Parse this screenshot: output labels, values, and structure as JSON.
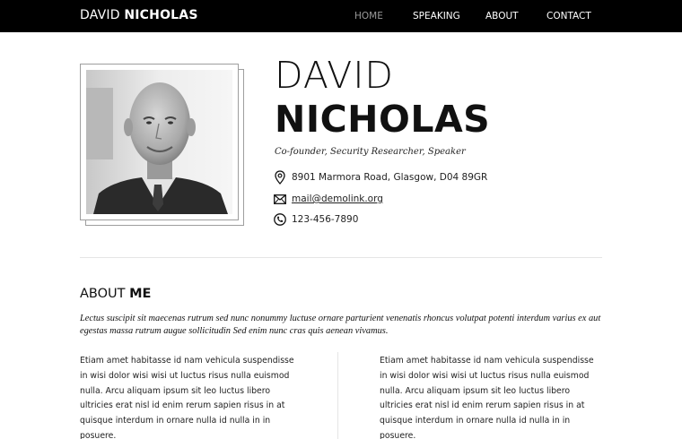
{
  "header": {
    "brand_first": "DAVID",
    "brand_last": "NICHOLAS",
    "nav": [
      {
        "label": "HOME",
        "active": true
      },
      {
        "label": "SPEAKING",
        "active": false
      },
      {
        "label": "ABOUT",
        "active": false
      },
      {
        "label": "CONTACT",
        "active": false
      }
    ]
  },
  "profile": {
    "first_name": "DAVID",
    "last_name": "NICHOLAS",
    "tagline": "Co-founder, Security Researcher, Speaker",
    "address": "8901 Marmora Road, Glasgow, D04 89GR",
    "email": "mail@demolink.org",
    "phone": "123-456-7890",
    "icons": [
      "map-pin-icon",
      "envelope-icon",
      "phone-icon"
    ]
  },
  "about": {
    "title_normal": "ABOUT",
    "title_bold": "ME",
    "intro": "Lectus suscipit sit maecenas rutrum sed nunc nonummy luctuse ornare parturient venenatis rhoncus volutpat potenti interdum varius ex aut egestas massa rutrum augue sollicitudin Sed enim nunc cras quis aenean vivamus.",
    "col_left": "Etiam amet  habitasse id nam vehicula suspendisse in wisi dolor wisi wisi ut luctus risus nulla euismod nulla. Arcu aliquam ipsum sit leo luctus libero ultricies erat nisl id enim rerum sapien risus in at quisque interdum in ornare nulla id nulla in in posuere.",
    "col_right": "Etiam amet  habitasse id nam vehicula suspendisse in wisi dolor wisi wisi ut luctus risus nulla euismod nulla. Arcu aliquam ipsum sit leo luctus libero ultricies erat nisl id enim rerum sapien risus in at quisque interdum in ornare nulla id nulla in in posuere."
  },
  "colors": {
    "topbar": "#000000",
    "nav_active": "#9a9a9a",
    "text": "#111111",
    "divider": "#e5e5e5"
  }
}
